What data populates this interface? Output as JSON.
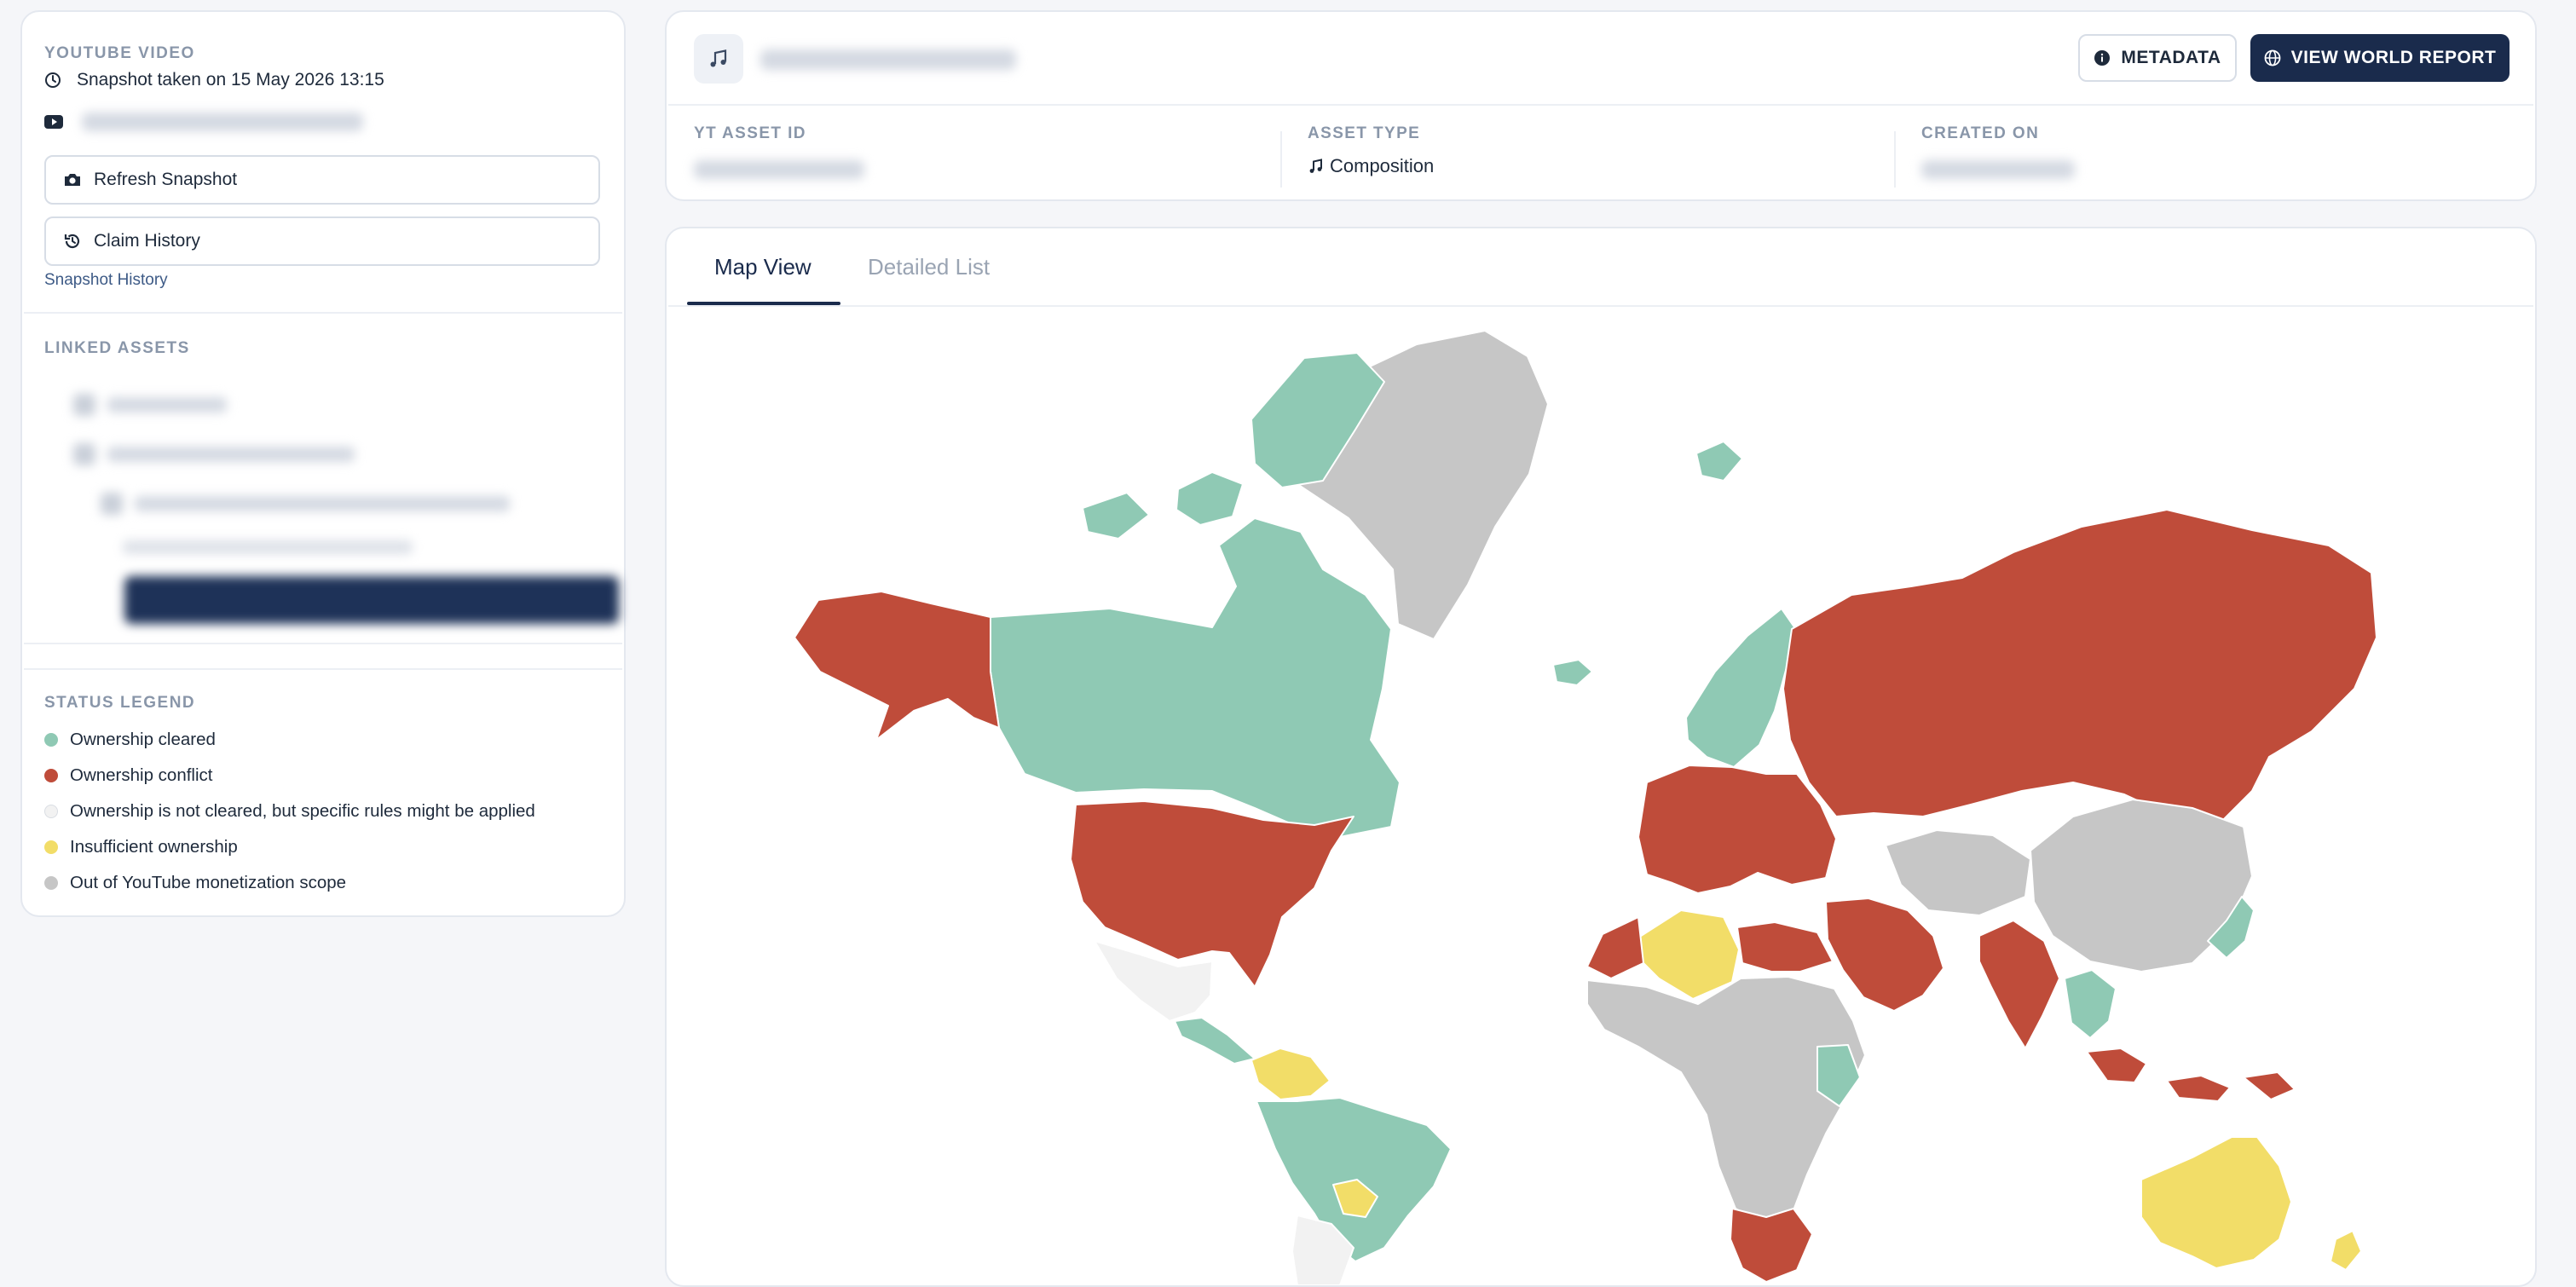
{
  "left_panel": {
    "youtube_video": {
      "section_title": "YOUTUBE VIDEO",
      "snapshot_text": "Snapshot taken on 15 May 2026 13:15",
      "refresh_label": "Refresh Snapshot",
      "claim_history_label": "Claim History",
      "snapshot_history_link": "Snapshot History"
    },
    "linked_assets": {
      "section_title": "LINKED ASSETS"
    },
    "legend": {
      "section_title": "STATUS LEGEND",
      "items": [
        {
          "label": "Ownership cleared",
          "color": "#8fc9b4"
        },
        {
          "label": "Ownership conflict",
          "color": "#bf4c3a"
        },
        {
          "label": "Ownership is not cleared, but specific rules might be applied",
          "color": "#f2f2f2"
        },
        {
          "label": "Insufficient ownership",
          "color": "#f2dd68"
        },
        {
          "label": "Out of YouTube monetization scope",
          "color": "#c6c6c6"
        }
      ]
    }
  },
  "header": {
    "metadata_button": "METADATA",
    "world_report_button": "VIEW WORLD REPORT",
    "fields": {
      "yt_asset_id_label": "YT ASSET ID",
      "asset_type_label": "ASSET TYPE",
      "asset_type_value": "Composition",
      "created_on_label": "CREATED ON"
    }
  },
  "tabs": {
    "map_view": "Map View",
    "detailed_list": "Detailed List",
    "active": "Map View"
  },
  "colors": {
    "cleared": "#8fc9b4",
    "conflict": "#bf4c3a",
    "rules": "#f2f2f2",
    "insufficient": "#f2dd68",
    "out_of_scope": "#c6c6c6",
    "primary": "#1a2b4c"
  },
  "map": {
    "regions": [
      {
        "name": "greenland",
        "status": "out_of_scope"
      },
      {
        "name": "canada",
        "status": "cleared"
      },
      {
        "name": "alaska",
        "status": "conflict"
      },
      {
        "name": "united-states",
        "status": "conflict"
      },
      {
        "name": "mexico",
        "status": "rules"
      },
      {
        "name": "central-america",
        "status": "cleared"
      },
      {
        "name": "venezuela",
        "status": "insufficient"
      },
      {
        "name": "brazil",
        "status": "cleared"
      },
      {
        "name": "paraguay",
        "status": "insufficient"
      },
      {
        "name": "argentina-chile",
        "status": "rules"
      },
      {
        "name": "iceland",
        "status": "cleared"
      },
      {
        "name": "scandinavia",
        "status": "cleared"
      },
      {
        "name": "europe",
        "status": "conflict"
      },
      {
        "name": "russia",
        "status": "conflict"
      },
      {
        "name": "algeria",
        "status": "insufficient"
      },
      {
        "name": "north-africa",
        "status": "conflict"
      },
      {
        "name": "middle-east",
        "status": "conflict"
      },
      {
        "name": "central-asia",
        "status": "out_of_scope"
      },
      {
        "name": "china-mongolia",
        "status": "out_of_scope"
      },
      {
        "name": "india",
        "status": "conflict"
      },
      {
        "name": "southeast-asia",
        "status": "cleared"
      },
      {
        "name": "indonesia",
        "status": "conflict"
      },
      {
        "name": "japan",
        "status": "cleared"
      },
      {
        "name": "africa",
        "status": "out_of_scope"
      },
      {
        "name": "south-africa",
        "status": "conflict"
      },
      {
        "name": "australia",
        "status": "insufficient"
      },
      {
        "name": "new-zealand",
        "status": "insufficient"
      }
    ]
  }
}
